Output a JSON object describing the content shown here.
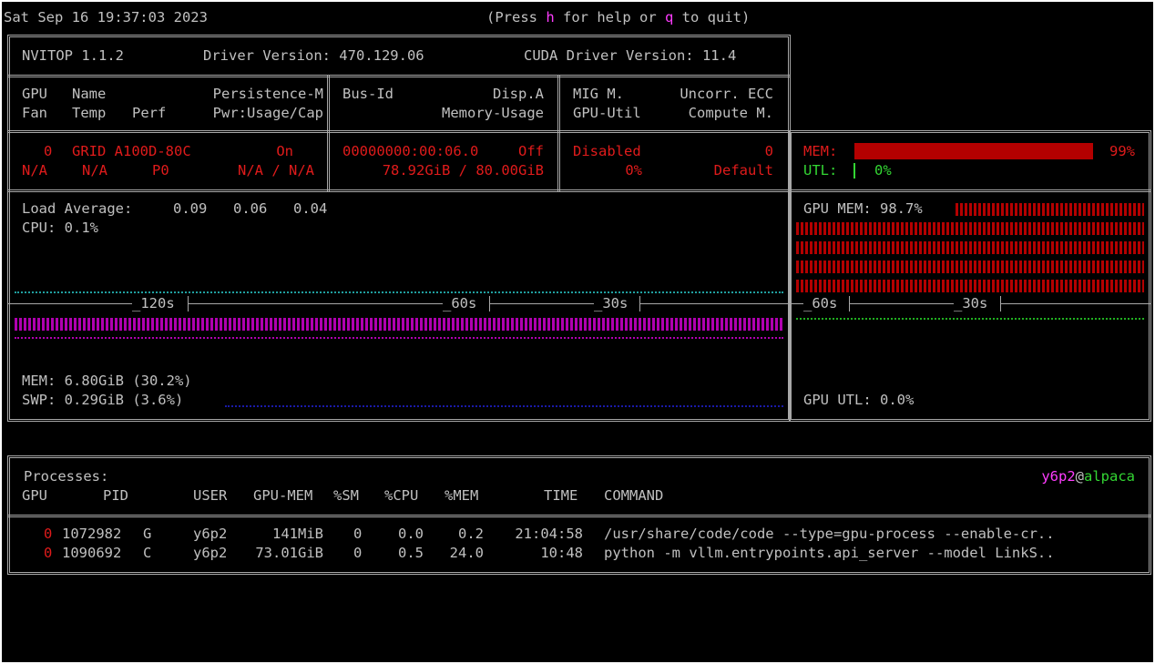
{
  "header": {
    "datetime": "Sat Sep 16 19:37:03 2023",
    "help_pre": "(Press ",
    "help_key": "h",
    "help_mid": " for help or ",
    "quit_key": "q",
    "help_post": " to quit)"
  },
  "topbar": {
    "version": "NVITOP 1.1.2",
    "driver": "Driver Version: 470.129.06",
    "cuda": "CUDA Driver Version: 11.4"
  },
  "columns": {
    "col1": {
      "l1a": "GPU",
      "l1b": "Name",
      "l1c": "Persistence-M",
      "l2a": "Fan",
      "l2b": "Temp",
      "l2c": "Perf",
      "l2d": "Pwr:Usage/Cap"
    },
    "col2": {
      "l1a": "Bus-Id",
      "l1b": "Disp.A",
      "l2": "Memory-Usage"
    },
    "col3": {
      "l1a": "MIG M.",
      "l1b": "Uncorr. ECC",
      "l2a": "GPU-Util",
      "l2b": "Compute M."
    }
  },
  "gpu": {
    "index": "0",
    "name": "GRID A100D-80C",
    "persistence": "On",
    "fan": "N/A",
    "temp": "N/A",
    "perf": "P0",
    "power": "N/A / N/A",
    "bus_id": "00000000:00:06.0",
    "disp": "Off",
    "memory_usage": "78.92GiB / 80.00GiB",
    "mig": "Disabled",
    "ecc": "0",
    "gpu_util": "0%",
    "compute_mode": "Default",
    "mem_label": "MEM:",
    "mem_pct": "99%",
    "mem_fraction": 0.99,
    "utl_label": "UTL:",
    "utl_pct": "0%",
    "utl_fraction": 0.0
  },
  "host": {
    "load_label": "Load Average:",
    "load_avg": [
      "0.09",
      "0.06",
      "0.04"
    ],
    "cpu": "CPU: 0.1%",
    "mem": "MEM: 6.80GiB (30.2%)",
    "swp": "SWP: 0.29GiB (3.6%)",
    "axis_labels": [
      "120s",
      "60s",
      "30s"
    ]
  },
  "gpu_history": {
    "mem": "GPU MEM: 98.7%",
    "util": "GPU UTL: 0.0%",
    "axis_labels": [
      "60s",
      "30s"
    ]
  },
  "processes": {
    "title": "Processes:",
    "user_host": {
      "user": "y6p2",
      "at": "@",
      "host": "alpaca"
    },
    "headers": [
      "GPU",
      "PID",
      "USER",
      "GPU-MEM",
      "%SM",
      "%CPU",
      "%MEM",
      "TIME",
      "COMMAND"
    ],
    "rows": [
      {
        "gpu": "0",
        "pid": "1072982",
        "type": "G",
        "user": "y6p2",
        "gpu_mem": "141MiB",
        "sm": "0",
        "cpu": "0.0",
        "mem": "0.2",
        "time": "21:04:58",
        "command": "/usr/share/code/code --type=gpu-process --enable-cr.."
      },
      {
        "gpu": "0",
        "pid": "1090692",
        "type": "C",
        "user": "y6p2",
        "gpu_mem": "73.01GiB",
        "sm": "0",
        "cpu": "0.5",
        "mem": "24.0",
        "time": "10:48",
        "command": "python -m vllm.entrypoints.api_server --model LinkS.."
      }
    ]
  },
  "colors": {
    "terminal_bg": "#000000",
    "text": "#c0c0c0",
    "error_red": "#e01b1b",
    "bar_red": "#b40000",
    "magenta": "#ff3cff",
    "green": "#33d633",
    "cyan": "#20a0a0",
    "purple": "#b000b0",
    "blue": "#1a1aa8"
  }
}
